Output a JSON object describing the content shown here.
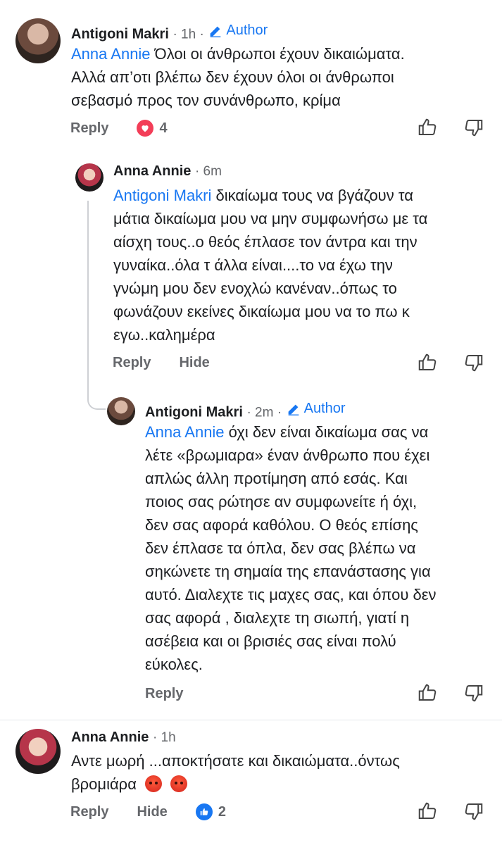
{
  "comments": [
    {
      "name": "Antigoni Makri",
      "meta": "· 1h ·",
      "author_label": "Author",
      "mention": "Anna Annie",
      "lines": [
        "Όλοι οι άνθρωποι έχουν δικαιώματα.",
        "Αλλά απ’οτι βλέπω δεν έχουν όλοι οι άνθρωποι",
        "σεβασμό προς τον συνάνθρωπο, κρίμα"
      ],
      "reply_label": "Reply",
      "reaction_count": "4",
      "reaction_type": "love"
    },
    {
      "name": "Anna Annie",
      "meta": "· 6m",
      "mention": "Antigoni Makri",
      "lines": [
        " δικαίωμα τους να βγάζουν τα",
        "μάτια δικαίωμα μου να μην συμφωνήσω με τα",
        "αίσχη τους..ο θεός έπλασε τον άντρα και την",
        "γυναίκα..όλα τ άλλα είναι....το να έχω την",
        "γνώμη μου δεν ενοχλώ κανέναν..όπως το",
        "φωνάζουν εκείνες δικαίωμα μου να το πω κ",
        "εγω..καλημέρα"
      ],
      "reply_label": "Reply",
      "hide_label": "Hide"
    },
    {
      "name": "Antigoni Makri",
      "meta": "· 2m ·",
      "author_label": "Author",
      "mention": "Anna Annie",
      "lines": [
        " όχι δεν είναι δικαίωμα σας να",
        "λέτε «βρωμιαρα» έναν άνθρωπο που έχει",
        "απλώς άλλη προτίμηση από εσάς. Και",
        "ποιος σας ρώτησε αν συμφωνείτε ή όχι,",
        "δεν σας αφορά καθόλου. Ο θεός επίσης",
        "δεν έπλασε τα όπλα, δεν σας βλέπω να",
        "σηκώνετε τη σημαία της επανάστασης για",
        "αυτό. Διαλεχτε τις μαχες σας, και όπου δεν",
        "σας αφορά , διαλεχτε τη σιωπή, γιατί η",
        "ασέβεια και οι βρισιές σας είναι πολύ",
        "εύκολες."
      ],
      "reply_label": "Reply"
    },
    {
      "name": "Anna Annie",
      "meta": "· 1h",
      "lines": [
        "Αντε μωρή ...αποκτήσατε και δικαιώματα..όντως",
        "βρομιάρα"
      ],
      "emoji_count": "2",
      "reply_label": "Reply",
      "hide_label": "Hide",
      "reaction_count": "2",
      "reaction_type": "like"
    }
  ],
  "colors": {
    "link": "#1877f2",
    "secondary": "#65676b",
    "love": "#f33e58",
    "like": "#1877f2"
  }
}
